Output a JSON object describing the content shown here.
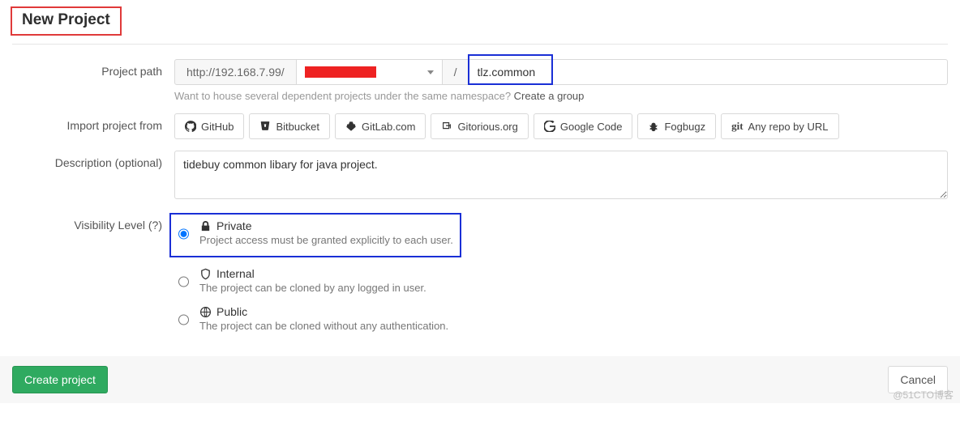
{
  "title": "New Project",
  "labels": {
    "project_path": "Project path",
    "import_from": "Import project from",
    "description": "Description (optional)",
    "visibility": "Visibility Level (?)"
  },
  "path": {
    "base_url": "http://192.168.7.99/",
    "separator": "/",
    "value": "tlz.common",
    "hint_prefix": "Want to house several dependent projects under the same namespace? ",
    "hint_link": "Create a group"
  },
  "import_buttons": [
    {
      "key": "github",
      "label": "GitHub",
      "icon": "github"
    },
    {
      "key": "bitbucket",
      "label": "Bitbucket",
      "icon": "bitbucket"
    },
    {
      "key": "gitlab",
      "label": "GitLab.com",
      "icon": "gitlab"
    },
    {
      "key": "gitorious",
      "label": "Gitorious.org",
      "icon": "gitorious"
    },
    {
      "key": "googlecode",
      "label": "Google Code",
      "icon": "google"
    },
    {
      "key": "fogbugz",
      "label": "Fogbugz",
      "icon": "bug"
    },
    {
      "key": "anyrepo",
      "label": "Any repo by URL",
      "icon": "git"
    }
  ],
  "description_value": "tidebuy common libary for java project.",
  "visibility": {
    "private": {
      "title": "Private",
      "sub": "Project access must be granted explicitly to each user."
    },
    "internal": {
      "title": "Internal",
      "sub": "The project can be cloned by any logged in user."
    },
    "public": {
      "title": "Public",
      "sub": "The project can be cloned without any authentication."
    },
    "selected": "private"
  },
  "actions": {
    "create": "Create project",
    "cancel": "Cancel"
  },
  "watermark": "@51CTO博客"
}
